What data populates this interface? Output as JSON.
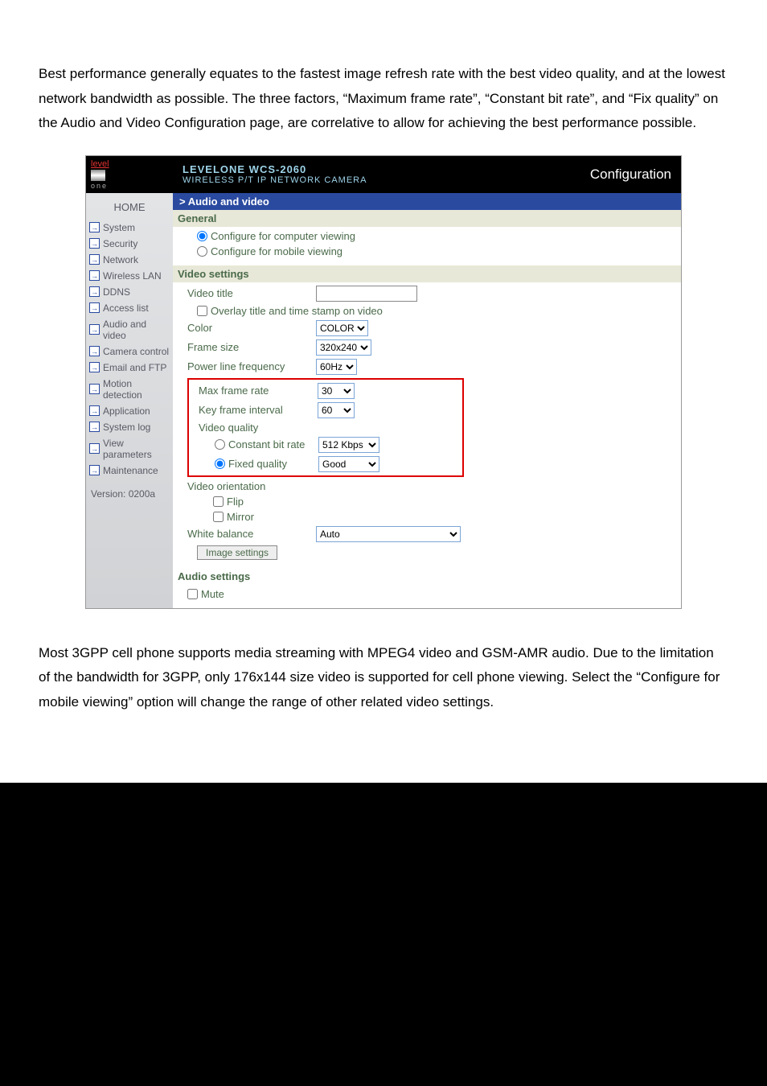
{
  "para_top": "Best performance generally equates to the fastest image refresh rate with the best video quality, and at the lowest network bandwidth as possible. The three factors, “Maximum frame rate”, “Constant bit rate”, and “Fix quality” on the Audio and Video Configuration page, are correlative to allow for achieving the best performance possible.",
  "para_bottom": "Most 3GPP cell phone supports media streaming with MPEG4 video and GSM-AMR audio. Due to the limitation of the bandwidth for 3GPP, only 176x144 size video is supported for cell phone viewing. Select the “Configure for mobile viewing” option will change the range of other related video settings.",
  "header": {
    "logo_top": "level",
    "logo_bottom": "one",
    "model": "LEVELONE WCS-2060",
    "subtitle": "WIRELESS P/T IP NETWORK CAMERA",
    "config_link": "Configuration"
  },
  "breadcrumb": "> Audio and video",
  "sidebar": {
    "home": "HOME",
    "items": [
      "System",
      "Security",
      "Network",
      "Wireless LAN",
      "DDNS",
      "Access list",
      "Audio and video",
      "Camera control",
      "Email and FTP",
      "Motion detection",
      "Application",
      "System log",
      "View parameters",
      "Maintenance"
    ],
    "version": "Version: 0200a"
  },
  "form": {
    "general": "General",
    "cfg_computer": "Configure for computer viewing",
    "cfg_mobile": "Configure for mobile viewing",
    "video_settings": "Video settings",
    "video_title": "Video title",
    "overlay": "Overlay title and time stamp on video",
    "color": "Color",
    "color_val": "COLOR",
    "frame_size": "Frame size",
    "frame_size_val": "320x240",
    "power_line": "Power line frequency",
    "power_line_val": "60Hz",
    "max_frame_rate": "Max frame rate",
    "max_frame_rate_val": "30",
    "key_frame": "Key frame interval",
    "key_frame_val": "60",
    "video_quality": "Video quality",
    "constant_bit": "Constant bit rate",
    "constant_bit_val": "512 Kbps",
    "fixed_quality": "Fixed quality",
    "fixed_quality_val": "Good",
    "video_orientation": "Video orientation",
    "flip": "Flip",
    "mirror": "Mirror",
    "white_balance": "White balance",
    "white_balance_val": "Auto",
    "image_settings_btn": "Image settings",
    "audio_settings": "Audio settings",
    "mute": "Mute"
  }
}
